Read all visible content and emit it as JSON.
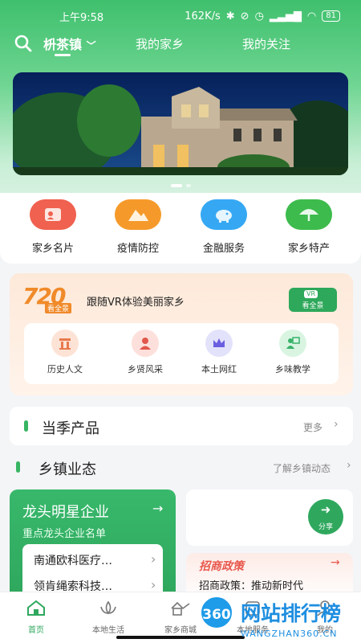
{
  "status_bar": {
    "time": "上午9:58",
    "network_speed": "162K/s",
    "battery": "81"
  },
  "header": {
    "location": "枡茶镇",
    "tabs": [
      "我的家乡",
      "我的关注"
    ]
  },
  "banner": {
    "slide_count": 2,
    "active_index": 0
  },
  "quick_menu": [
    {
      "label": "家乡名片",
      "icon": "hometown-card-icon",
      "color": "#f0614f"
    },
    {
      "label": "疫情防控",
      "icon": "mountain-icon",
      "color": "#f59a2a"
    },
    {
      "label": "金融服务",
      "icon": "piggy-bank-icon",
      "color": "#36a8f3"
    },
    {
      "label": "家乡特产",
      "icon": "fan-icon",
      "color": "#3dbb4c"
    }
  ],
  "vr_section": {
    "logo_number": "720",
    "logo_text": "看全景",
    "title": "跟随VR体验美丽家乡",
    "button_badge": "VR",
    "button_label": "看全景",
    "items": [
      {
        "label": "历史人文",
        "icon": "temple-icon",
        "bg": "#fde3d6",
        "fg": "#e8794c"
      },
      {
        "label": "乡贤风采",
        "icon": "person-icon",
        "bg": "#fde0dc",
        "fg": "#e2574c"
      },
      {
        "label": "本土网红",
        "icon": "crown-icon",
        "bg": "#e3e2fb",
        "fg": "#6a5fe0"
      },
      {
        "label": "乡味教学",
        "icon": "teacher-icon",
        "bg": "#d9f5e2",
        "fg": "#39b26a"
      }
    ]
  },
  "seasonal": {
    "title": "当季产品",
    "more": "更多"
  },
  "town_business": {
    "title": "乡镇业态",
    "more": "了解乡镇动态"
  },
  "enterprise": {
    "title": "龙头明星企业",
    "subtitle": "重点龙头企业名单",
    "items": [
      "南通欧科医疗…",
      "领肯绳索科技…"
    ]
  },
  "share": {
    "label": "分享"
  },
  "policy": {
    "header": "招商政策",
    "text": "招商政策：推动新时代"
  },
  "tab_bar": [
    {
      "label": "首页",
      "icon": "home-icon",
      "active": true
    },
    {
      "label": "本地生活",
      "icon": "lotus-icon",
      "active": false
    },
    {
      "label": "家乡商城",
      "icon": "house-icon",
      "active": false
    },
    {
      "label": "本地服务",
      "icon": "service-icon",
      "active": false
    },
    {
      "label": "我的",
      "icon": "user-icon",
      "active": false
    }
  ],
  "watermark": {
    "badge": "360",
    "title": "网站排行榜",
    "url": "WANGZHAN360.CN"
  },
  "colors": {
    "accent": "#37b563",
    "active_tab": "#2fa85e"
  }
}
